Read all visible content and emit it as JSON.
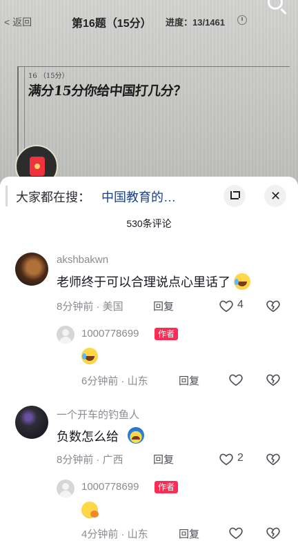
{
  "exam": {
    "back_label": "< 返回",
    "title": "第16题（15分）",
    "progress": "进度：13/1461",
    "question_number": "16 （15分）",
    "question_text": "满分15分你给中国打几分？"
  },
  "sheet": {
    "search_prefix": "大家都在搜：",
    "search_link": "中国教育的…",
    "comment_count": "530条评论"
  },
  "comments": [
    {
      "username": "akshbakwn",
      "text": "老师终于可以合理说点心里话了",
      "emoji": "laughing-tears-emoji",
      "meta": "8分钟前 · 美国",
      "reply_label": "回复",
      "likes": "4",
      "reply": {
        "username": "1000778699",
        "badge": "作者",
        "emoji": "laughing-tears-emoji",
        "meta": "6分钟前 · 山东",
        "reply_label": "回复"
      }
    },
    {
      "username": "一个开车的钓鱼人",
      "text": "负数怎么给",
      "emoji": "crying-emoji",
      "meta": "8分钟前 · 广西",
      "reply_label": "回复",
      "likes": "2",
      "reply": {
        "username": "1000778699",
        "badge": "作者",
        "emoji": "thinking-emoji",
        "meta": "4分钟前 · 山东",
        "reply_label": "回复"
      }
    }
  ]
}
